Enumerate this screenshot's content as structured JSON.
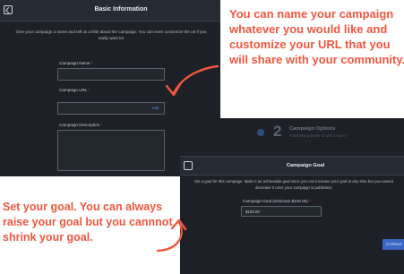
{
  "panel1": {
    "title": "Basic Information",
    "intro": "Give your campaign a name and tell us a little about the campaign. You can even customize the url if you really want to!",
    "campaign_name_label": "Campaign Name",
    "campaign_url_label": "Campaign URL",
    "edit_label": "edit",
    "campaign_description_label": "Campaign Description",
    "required_marker": "*"
  },
  "panel2": {
    "step_number": "2",
    "step_title": "Campaign Options",
    "step_subtitle": "Fundraising desire or with a team?",
    "title": "Campaign Goal",
    "intro": "Set a goal for this campaign. Make it an achievable goal since you can increase your goal at any time but you cannot decrease it once your campaign is published.",
    "goal_label": "Campaign Goal (minimum $100.00)",
    "goal_value": "$100.00",
    "continue_label": "Continue"
  },
  "annotations": {
    "note_url": "You can name your campaign whatever you would like and customize your URL that you will share with your community.",
    "note_goal": "Set your goal.  You can always raise your goal but you cannnot shrink your goal."
  },
  "colors": {
    "annotation": "#f0573f",
    "panel_bg": "#1d2026",
    "accent": "#3a67c4"
  }
}
